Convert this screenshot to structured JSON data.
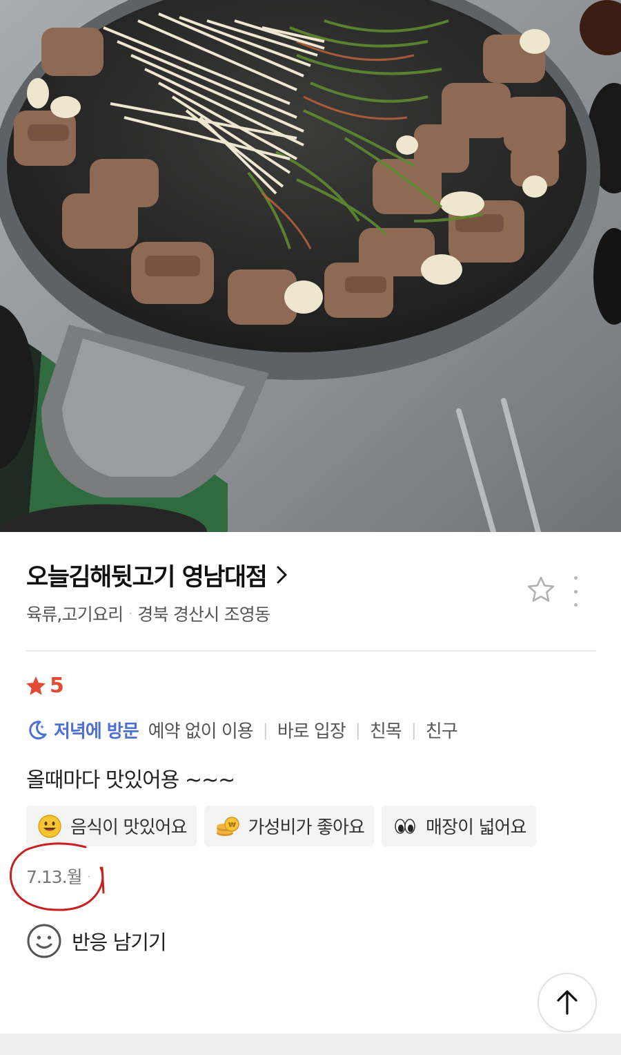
{
  "photo": {
    "alt_icon": "food-photo"
  },
  "place": {
    "name": "오늘김해뒷고기 영남대점",
    "category": "육류,고기요리",
    "location": "경북 경산시 조영동"
  },
  "review": {
    "rating": "5",
    "visit_time": "저녁에 방문",
    "visit_tags": [
      "예약 없이 이용",
      "바로 입장",
      "친목",
      "친구"
    ],
    "text": "올때마다 맛있어용 ~~~",
    "keywords": [
      {
        "label": "음식이 맛있어요",
        "icon": "smile-face-emoji-icon"
      },
      {
        "label": "가성비가 좋아요",
        "icon": "coins-emoji-icon"
      },
      {
        "label": "매장이 넓어요",
        "icon": "eyes-emoji-icon"
      }
    ],
    "date": "7.13.월"
  },
  "reaction": {
    "label": "반응 남기기"
  },
  "colors": {
    "accent_red": "#e34a34",
    "visit_blue": "#4d6fd6",
    "annotation_red": "#c8201e"
  }
}
